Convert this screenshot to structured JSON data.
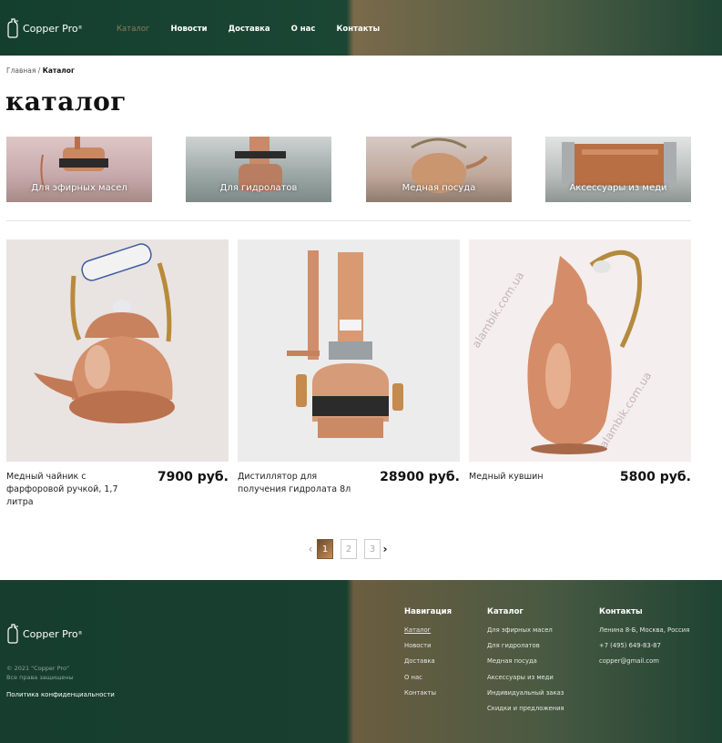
{
  "header": {
    "logo": "Copper Pro",
    "nav": [
      "Каталог",
      "Новости",
      "Доставка",
      "О нас",
      "Контакты"
    ]
  },
  "breadcrumb": {
    "home": "Главная",
    "separator": " / ",
    "current": "Каталог"
  },
  "page_title": "каталог",
  "categories": [
    "Для эфирных масел",
    "Для гидролатов",
    "Медная посуда",
    "Аксессуары из меди"
  ],
  "products": [
    {
      "name": "Медный чайник с фарфоровой ручкой, 1,7 литра",
      "price": "7900 руб."
    },
    {
      "name": "Дистиллятор для получения гидролата 8л",
      "price": "28900 руб."
    },
    {
      "name": "Медный кувшин",
      "price": "5800 руб."
    }
  ],
  "watermark": "alambik.com.ua",
  "pagination": {
    "pages": [
      "1",
      "2",
      "3"
    ],
    "current": 1,
    "prev": "‹",
    "next": "›"
  },
  "footer": {
    "logo": "Copper Pro",
    "copyright": "© 2021 \"Copper Pro\"",
    "rights": "Все права защищены",
    "policy": "Политика конфиденциальности",
    "nav_title": "Навигация",
    "nav": [
      "Каталог",
      "Новости",
      "Доставка",
      "О нас",
      "Контакты"
    ],
    "catalog_title": "Каталог",
    "catalog": [
      "Для эфирных масел",
      "Для гидролатов",
      "Медная посуда",
      "Аксессуары из меди",
      "Индивидуальный заказ",
      "Скидки и предложения"
    ],
    "contacts_title": "Контакты",
    "address": "Ленина 8-Б, Москва, Россия",
    "phone": "+7 (495) 649-83-87",
    "email": "copper@gmail.com"
  },
  "colors": {
    "brand_green": "#163d2e",
    "copper": "#b07a48",
    "accent_gold": "#8d7d5a"
  }
}
